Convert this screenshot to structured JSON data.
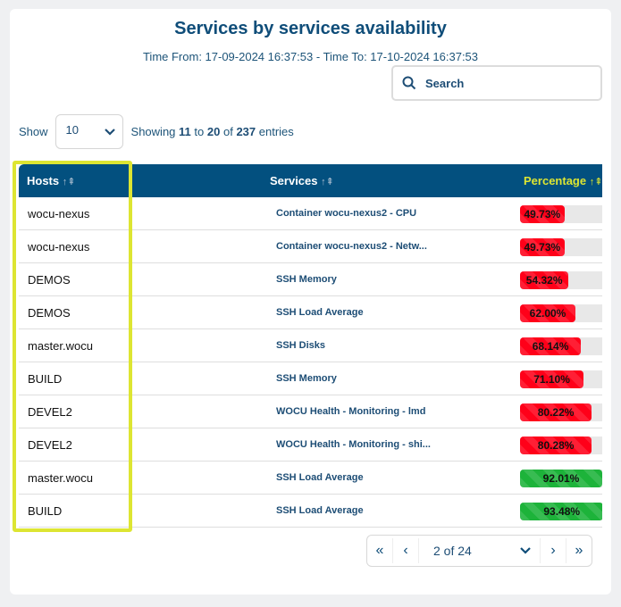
{
  "title": "Services by services availability",
  "time_range": "Time From: 17-09-2024 16:37:53 - Time To: 17-10-2024 16:37:53",
  "search": {
    "label": "Search",
    "icon": "search-icon"
  },
  "show": {
    "label": "Show",
    "value": "10"
  },
  "showing": {
    "prefix": "Showing",
    "from": "11",
    "to_word": "to",
    "to": "20",
    "of_word": "of",
    "total": "237",
    "suffix": "entries"
  },
  "columns": {
    "hosts": "Hosts",
    "services": "Services",
    "percentage": "Percentage",
    "sort_icon": "sort-icon"
  },
  "colors": {
    "header": "#03507f",
    "active_sort": "#dde532",
    "low": "#ff0019",
    "high": "#1db33a",
    "highlight": "#dde532"
  },
  "rows": [
    {
      "host": "wocu-nexus",
      "service": "Container wocu-nexus2 - CPU",
      "pct_label": "49.73%",
      "pct": 49.73,
      "status": "low"
    },
    {
      "host": "wocu-nexus",
      "service": "Container wocu-nexus2 - Netw...",
      "pct_label": "49.73%",
      "pct": 49.73,
      "status": "low"
    },
    {
      "host": "DEMOS",
      "service": "SSH Memory",
      "pct_label": "54.32%",
      "pct": 54.32,
      "status": "low"
    },
    {
      "host": "DEMOS",
      "service": "SSH Load Average",
      "pct_label": "62.00%",
      "pct": 62.0,
      "status": "low"
    },
    {
      "host": "master.wocu",
      "service": "SSH Disks",
      "pct_label": "68.14%",
      "pct": 68.14,
      "status": "low"
    },
    {
      "host": "BUILD",
      "service": "SSH Memory",
      "pct_label": "71.10%",
      "pct": 71.1,
      "status": "low"
    },
    {
      "host": "DEVEL2",
      "service": "WOCU Health - Monitoring - lmd",
      "pct_label": "80.22%",
      "pct": 80.22,
      "status": "low"
    },
    {
      "host": "DEVEL2",
      "service": "WOCU Health - Monitoring - shi...",
      "pct_label": "80.28%",
      "pct": 80.28,
      "status": "low"
    },
    {
      "host": "master.wocu",
      "service": "SSH Load Average",
      "pct_label": "92.01%",
      "pct": 92.01,
      "status": "high"
    },
    {
      "host": "BUILD",
      "service": "SSH Load Average",
      "pct_label": "93.48%",
      "pct": 93.48,
      "status": "high"
    }
  ],
  "pager": {
    "page_label": "2 of 24",
    "first": "«",
    "prev": "‹",
    "next": "›",
    "last": "»"
  }
}
